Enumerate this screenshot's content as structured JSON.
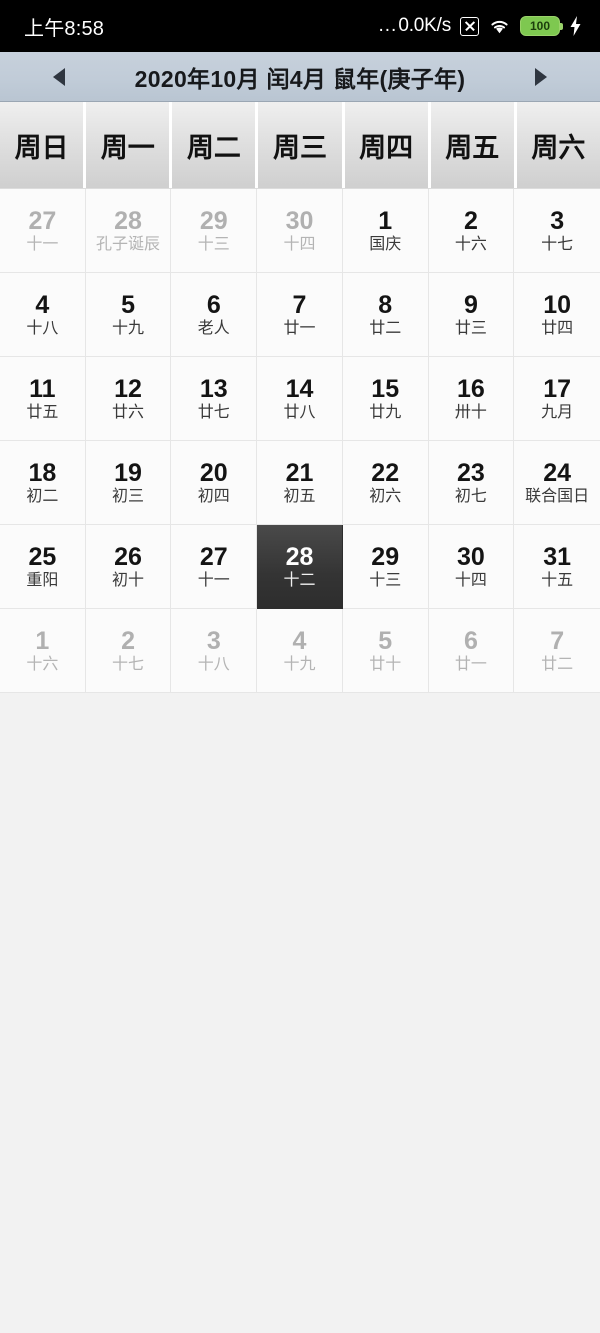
{
  "status_bar": {
    "clock": "上午8:58",
    "net_dots": "...",
    "net_speed": "0.0K/s",
    "no_sim_icon": "no-sim-icon",
    "wifi_icon": "wifi-icon",
    "battery_level": "100",
    "charging_icon": "charging-bolt-icon"
  },
  "title_bar": {
    "prev_label": "prev-month-arrow",
    "next_label": "next-month-arrow",
    "title": "2020年10月 闰4月 鼠年(庚子年)"
  },
  "weekdays": [
    "周日",
    "周一",
    "周二",
    "周三",
    "周四",
    "周五",
    "周六"
  ],
  "colors": {
    "selected_bg": "#343434",
    "title_bar_bg": "#c1ccd8",
    "battery_green": "#7ec850",
    "status_bar_bg": "#000000"
  },
  "selected_date": "28",
  "days": [
    {
      "num": "27",
      "lunar": "十一",
      "month": "prev",
      "selected": false
    },
    {
      "num": "28",
      "lunar": "孔子诞辰",
      "month": "prev",
      "selected": false
    },
    {
      "num": "29",
      "lunar": "十三",
      "month": "prev",
      "selected": false
    },
    {
      "num": "30",
      "lunar": "十四",
      "month": "prev",
      "selected": false
    },
    {
      "num": "1",
      "lunar": "国庆",
      "month": "current",
      "selected": false
    },
    {
      "num": "2",
      "lunar": "十六",
      "month": "current",
      "selected": false
    },
    {
      "num": "3",
      "lunar": "十七",
      "month": "current",
      "selected": false
    },
    {
      "num": "4",
      "lunar": "十八",
      "month": "current",
      "selected": false
    },
    {
      "num": "5",
      "lunar": "十九",
      "month": "current",
      "selected": false
    },
    {
      "num": "6",
      "lunar": "老人",
      "month": "current",
      "selected": false
    },
    {
      "num": "7",
      "lunar": "廿一",
      "month": "current",
      "selected": false
    },
    {
      "num": "8",
      "lunar": "廿二",
      "month": "current",
      "selected": false
    },
    {
      "num": "9",
      "lunar": "廿三",
      "month": "current",
      "selected": false
    },
    {
      "num": "10",
      "lunar": "廿四",
      "month": "current",
      "selected": false
    },
    {
      "num": "11",
      "lunar": "廿五",
      "month": "current",
      "selected": false
    },
    {
      "num": "12",
      "lunar": "廿六",
      "month": "current",
      "selected": false
    },
    {
      "num": "13",
      "lunar": "廿七",
      "month": "current",
      "selected": false
    },
    {
      "num": "14",
      "lunar": "廿八",
      "month": "current",
      "selected": false
    },
    {
      "num": "15",
      "lunar": "廿九",
      "month": "current",
      "selected": false
    },
    {
      "num": "16",
      "lunar": "卅十",
      "month": "current",
      "selected": false
    },
    {
      "num": "17",
      "lunar": "九月",
      "month": "current",
      "selected": false
    },
    {
      "num": "18",
      "lunar": "初二",
      "month": "current",
      "selected": false
    },
    {
      "num": "19",
      "lunar": "初三",
      "month": "current",
      "selected": false
    },
    {
      "num": "20",
      "lunar": "初四",
      "month": "current",
      "selected": false
    },
    {
      "num": "21",
      "lunar": "初五",
      "month": "current",
      "selected": false
    },
    {
      "num": "22",
      "lunar": "初六",
      "month": "current",
      "selected": false
    },
    {
      "num": "23",
      "lunar": "初七",
      "month": "current",
      "selected": false
    },
    {
      "num": "24",
      "lunar": "联合国日",
      "month": "current",
      "selected": false
    },
    {
      "num": "25",
      "lunar": "重阳",
      "month": "current",
      "selected": false
    },
    {
      "num": "26",
      "lunar": "初十",
      "month": "current",
      "selected": false
    },
    {
      "num": "27",
      "lunar": "十一",
      "month": "current",
      "selected": false
    },
    {
      "num": "28",
      "lunar": "十二",
      "month": "current",
      "selected": true
    },
    {
      "num": "29",
      "lunar": "十三",
      "month": "current",
      "selected": false
    },
    {
      "num": "30",
      "lunar": "十四",
      "month": "current",
      "selected": false
    },
    {
      "num": "31",
      "lunar": "十五",
      "month": "current",
      "selected": false
    },
    {
      "num": "1",
      "lunar": "十六",
      "month": "next",
      "selected": false
    },
    {
      "num": "2",
      "lunar": "十七",
      "month": "next",
      "selected": false
    },
    {
      "num": "3",
      "lunar": "十八",
      "month": "next",
      "selected": false
    },
    {
      "num": "4",
      "lunar": "十九",
      "month": "next",
      "selected": false
    },
    {
      "num": "5",
      "lunar": "廿十",
      "month": "next",
      "selected": false
    },
    {
      "num": "6",
      "lunar": "廿一",
      "month": "next",
      "selected": false
    },
    {
      "num": "7",
      "lunar": "廿二",
      "month": "next",
      "selected": false
    }
  ]
}
